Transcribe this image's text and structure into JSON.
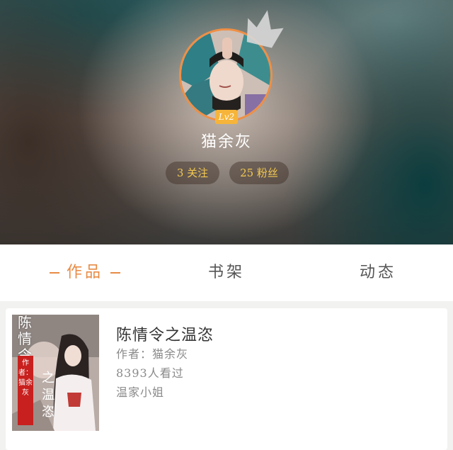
{
  "profile": {
    "level": "Lv2",
    "username": "猫余灰",
    "following_label": "3 关注",
    "fans_label": "25 粉丝"
  },
  "tabs": [
    {
      "label": "作品",
      "active": true
    },
    {
      "label": "书架",
      "active": false
    },
    {
      "label": "动态",
      "active": false
    }
  ],
  "works": [
    {
      "title": "陈情令之温恣",
      "author_line": "作者：猫余灰",
      "views": "8393人看过",
      "tag": "温家小姐",
      "cover": {
        "title_top": "陈情令",
        "title_bottom": "之温恣",
        "author_vertical": "作者：猫余灰"
      }
    }
  ],
  "colors": {
    "accent": "#e88b45",
    "badge": "#f6b53a",
    "stat_text": "#f3c850",
    "cover_author_bg": "#c8201e"
  }
}
